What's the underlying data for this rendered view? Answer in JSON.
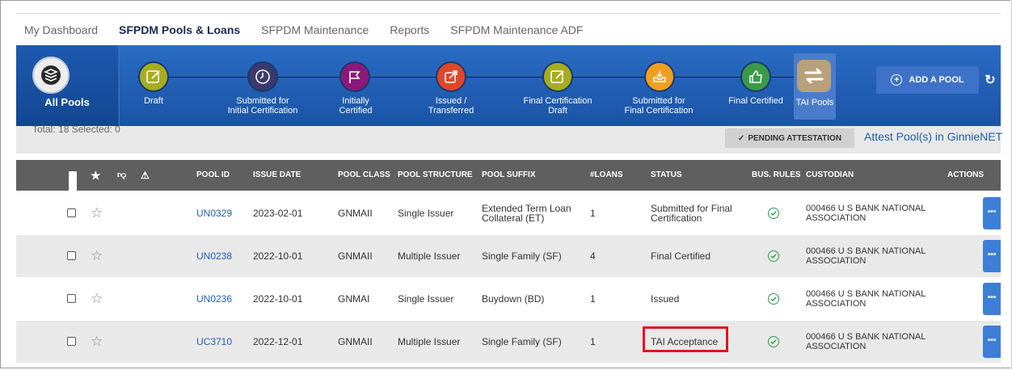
{
  "tabs": [
    "My Dashboard",
    "SFPDM Pools & Loans",
    "SFPDM Maintenance",
    "Reports",
    "SFPDM Maintenance ADF"
  ],
  "active_tab": "SFPDM Pools & Loans",
  "workflow": {
    "all_pools": "All Pools",
    "steps": [
      {
        "label1": "Draft",
        "label2": "",
        "color": "#a6ad1f",
        "icon": "pencil-icon"
      },
      {
        "label1": "Submitted for",
        "label2": "Initial Certification",
        "color": "#3a3a6e",
        "icon": "clock-icon"
      },
      {
        "label1": "Initially",
        "label2": "Certified",
        "color": "#8a1a7a",
        "icon": "flag-icon"
      },
      {
        "label1": "Issued /",
        "label2": "Transferred",
        "color": "#e0462a",
        "icon": "share-icon"
      },
      {
        "label1": "Final Certification",
        "label2": "Draft",
        "color": "#a6ad1f",
        "icon": "pencil-icon"
      },
      {
        "label1": "Submitted for",
        "label2": "Final Certification",
        "color": "#f0a020",
        "icon": "inbox-icon"
      },
      {
        "label1": "Final Certified",
        "label2": "",
        "color": "#3a9a4a",
        "icon": "thumbs-up-icon"
      }
    ],
    "tai_pools": "TAI Pools",
    "add_pool": "ADD A POOL"
  },
  "subbar": {
    "total_text": "Total: 18 Selected: 0",
    "pending_attestation": "PENDING ATTESTATION",
    "attest_link": "Attest Pool(s) in GinnieNET"
  },
  "columns": [
    "POOL ID",
    "ISSUE DATE",
    "POOL CLASS",
    "POOL STRUCTURE",
    "POOL SUFFIX",
    "#LOANS",
    "STATUS",
    "BUS. RULES",
    "CUSTODIAN",
    "ACTIONS"
  ],
  "rows": [
    {
      "pool_id": "UN0329",
      "issue_date": "2023-02-01",
      "pool_class": "GNMAII",
      "structure": "Single Issuer",
      "suffix1": "Extended Term Loan",
      "suffix2": "Collateral (ET)",
      "loans": "1",
      "status1": "Submitted for Final",
      "status2": "Certification",
      "custodian1": "000466 U S BANK NATIONAL",
      "custodian2": "ASSOCIATION"
    },
    {
      "pool_id": "UN0238",
      "issue_date": "2022-10-01",
      "pool_class": "GNMAII",
      "structure": "Multiple Issuer",
      "suffix1": "Single Family (SF)",
      "suffix2": "",
      "loans": "4",
      "status1": "Final Certified",
      "status2": "",
      "custodian1": "000466 U S BANK NATIONAL",
      "custodian2": "ASSOCIATION"
    },
    {
      "pool_id": "UN0236",
      "issue_date": "2022-10-01",
      "pool_class": "GNMAI",
      "structure": "Single Issuer",
      "suffix1": "Buydown (BD)",
      "suffix2": "",
      "loans": "1",
      "status1": "Issued",
      "status2": "",
      "custodian1": "000466 U S BANK NATIONAL",
      "custodian2": "ASSOCIATION"
    },
    {
      "pool_id": "UC3710",
      "issue_date": "2022-12-01",
      "pool_class": "GNMAII",
      "structure": "Multiple Issuer",
      "suffix1": "Single Family (SF)",
      "suffix2": "",
      "loans": "1",
      "status1": "TAI Acceptance",
      "status2": "",
      "custodian1": "000466 U S BANK NATIONAL",
      "custodian2": "ASSOCIATION"
    }
  ],
  "colors": {
    "header_blue": "#1b54a6",
    "table_header": "#5f5f5f",
    "link": "#1f5fb0",
    "highlight": "#e0141e"
  }
}
